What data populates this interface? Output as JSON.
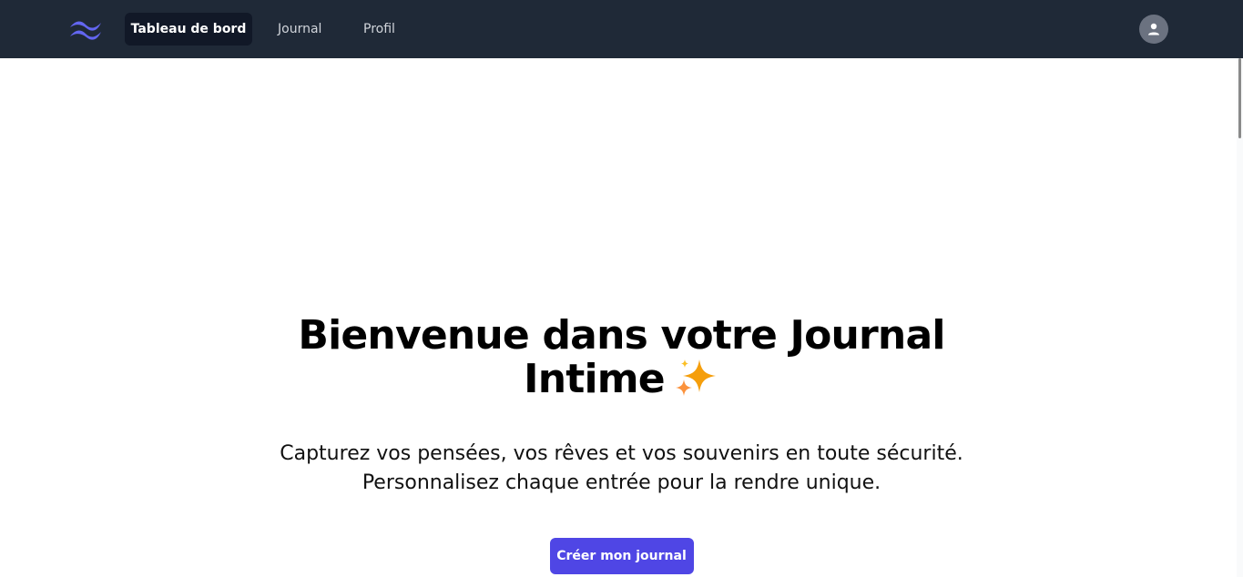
{
  "nav": {
    "items": [
      {
        "label": "Tableau de bord",
        "active": true
      },
      {
        "label": "Journal",
        "active": false
      },
      {
        "label": "Profil",
        "active": false
      }
    ],
    "logo_icon": "tailwind-wave-icon",
    "avatar_icon": "user-icon"
  },
  "hero": {
    "title": "Bienvenue dans votre Journal Intime",
    "title_icon": "sparkles-icon",
    "subtitle_line1": "Capturez vos pensées, vos rêves et vos souvenirs en toute sécurité.",
    "subtitle_line2": "Personnalisez chaque entrée pour la rendre unique.",
    "cta_label": "Créer mon journal"
  },
  "colors": {
    "navbar_bg": "#1f2937",
    "active_tab_bg": "#111827",
    "accent": "#4f46e5",
    "logo": "#6366f1",
    "avatar_bg": "#6b7280",
    "sparkle": "#f59e0b"
  }
}
